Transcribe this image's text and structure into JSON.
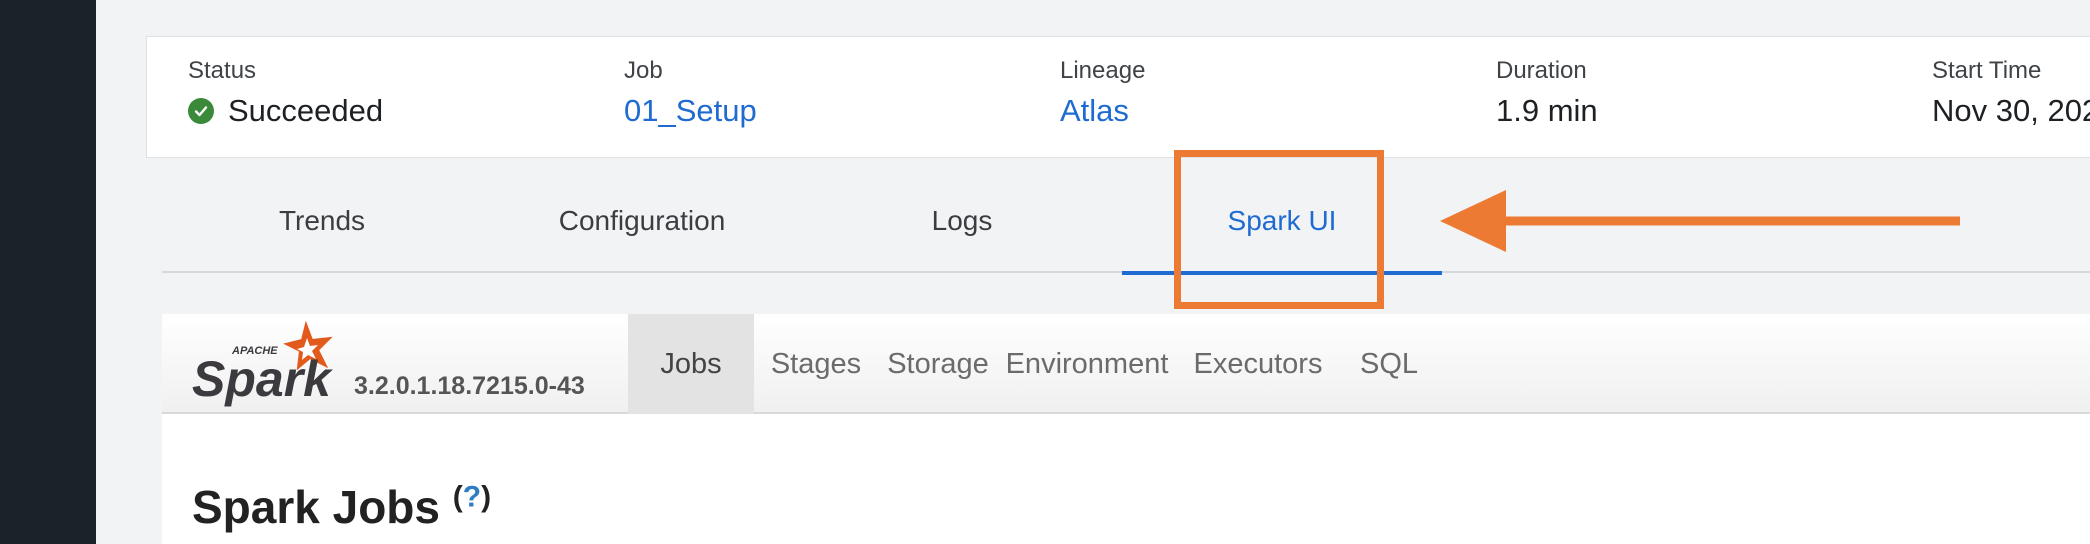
{
  "summary": {
    "status": {
      "label": "Status",
      "value": "Succeeded"
    },
    "job": {
      "label": "Job",
      "value": "01_Setup"
    },
    "lineage": {
      "label": "Lineage",
      "value": "Atlas"
    },
    "duration": {
      "label": "Duration",
      "value": "1.9 min"
    },
    "start_time": {
      "label": "Start Time",
      "value": "Nov 30, 202"
    }
  },
  "main_tabs": [
    "Trends",
    "Configuration",
    "Logs",
    "Spark UI"
  ],
  "active_main_tab": "Spark UI",
  "spark": {
    "logo_small_text": "APACHE",
    "logo_text": "Spark",
    "version": "3.2.0.1.18.7215.0-43",
    "tabs": [
      "Jobs",
      "Stages",
      "Storage",
      "Environment",
      "Executors",
      "SQL"
    ],
    "active_tab": "Jobs",
    "heading": "Spark Jobs",
    "help_open": "(",
    "help_q": "?",
    "help_close": ")"
  },
  "colors": {
    "accent": "#1f6bd1",
    "annotation": "#ec7a33",
    "success": "#3a8a3a",
    "rail": "#1a2329"
  },
  "icons": {
    "status": "check-circle-icon",
    "annotation": "arrow-left-icon"
  }
}
